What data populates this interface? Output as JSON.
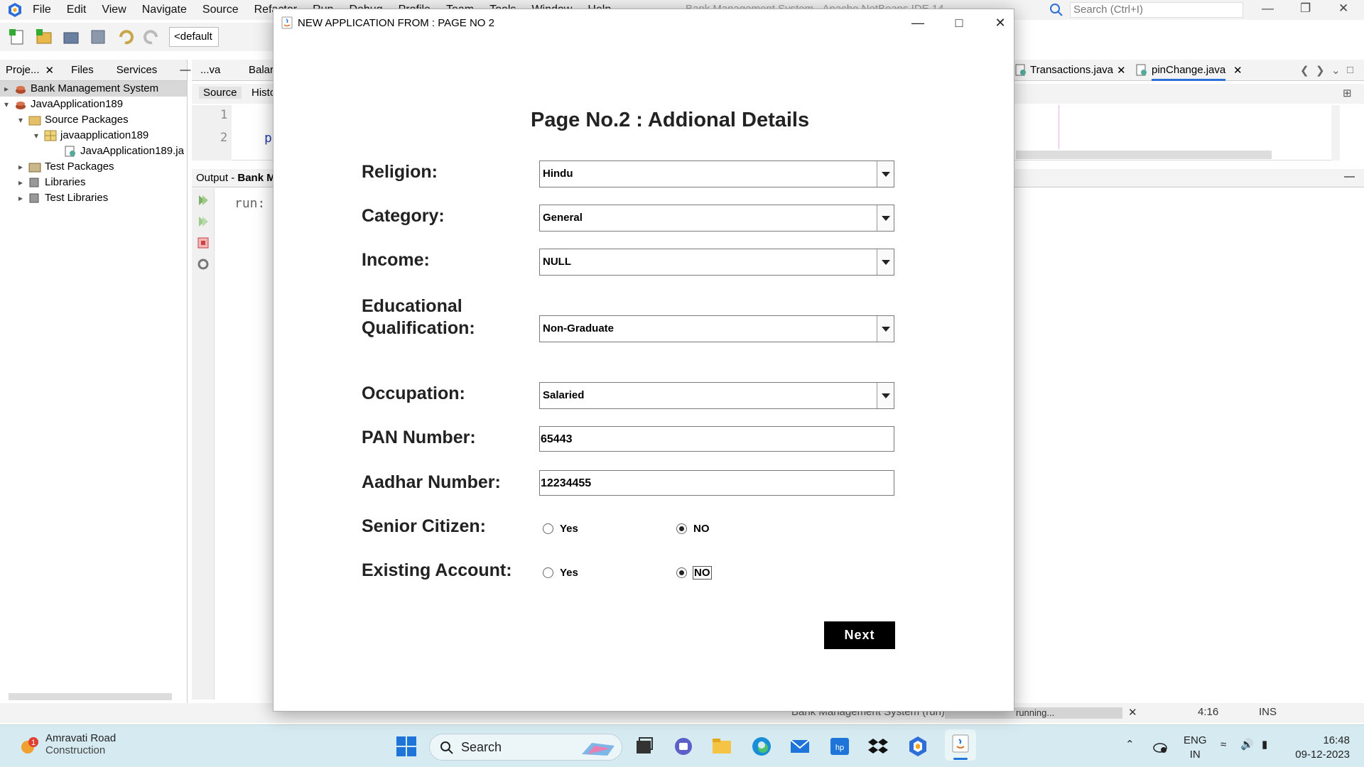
{
  "ide": {
    "menu": [
      "File",
      "Edit",
      "View",
      "Navigate",
      "Source",
      "Refactor",
      "Run",
      "Debug",
      "Profile",
      "Team",
      "Tools",
      "Window",
      "Help"
    ],
    "window_title": "Bank Management System - Apache NetBeans IDE 14",
    "search_placeholder": "Search (Ctrl+I)",
    "config_combo": "<default",
    "left_tabs": [
      "Proje...",
      "Files",
      "Services"
    ],
    "tree": [
      {
        "label": "Bank Management System",
        "level": 0
      },
      {
        "label": "JavaApplication189",
        "level": 0
      },
      {
        "label": "Source Packages",
        "level": 1
      },
      {
        "label": "javaapplication189",
        "level": 2
      },
      {
        "label": "JavaApplication189.ja",
        "level": 3
      },
      {
        "label": "Test Packages",
        "level": 1
      },
      {
        "label": "Libraries",
        "level": 1
      },
      {
        "label": "Test Libraries",
        "level": 1
      }
    ],
    "editor_tabs": [
      "...va",
      "Balar",
      "Transactions.java",
      "pinChange.java"
    ],
    "source_tab": "Source",
    "history_tab": "Histo",
    "line_numbers": [
      "1",
      "2"
    ],
    "code_char": "p",
    "output_label": "Output - ",
    "output_project": "Bank M",
    "output_text": "run:",
    "status": {
      "task": "Bank Management System (run)",
      "progress": "running...",
      "position": "4:16",
      "mode": "INS"
    }
  },
  "taskbar": {
    "weather_title": "Amravati Road",
    "weather_sub": "Construction",
    "weather_badge": "1",
    "search_label": "Search",
    "lang": "ENG",
    "region": "IN",
    "time": "16:48",
    "date": "09-12-2023"
  },
  "dialog": {
    "title": "NEW APPLICATION FROM : PAGE NO 2",
    "heading": "Page No.2 : Addional Details",
    "religion_label": "Religion:",
    "religion_value": "Hindu",
    "category_label": "Category:",
    "category_value": "General",
    "income_label": "Income:",
    "income_value": "NULL",
    "education_label_1": "Educational",
    "education_label_2": "Qualification:",
    "education_value": "Non-Graduate",
    "occupation_label": "Occupation:",
    "occupation_value": "Salaried",
    "pan_label": "PAN Number:",
    "pan_value": "65443",
    "aadhar_label": "Aadhar Number:",
    "aadhar_value": "12234455",
    "senior_label": "Senior Citizen:",
    "existing_label": "Existing Account:",
    "yes_label": "Yes",
    "no_label": "NO",
    "senior_selected": "NO",
    "existing_selected": "NO",
    "next_label": "Next"
  }
}
